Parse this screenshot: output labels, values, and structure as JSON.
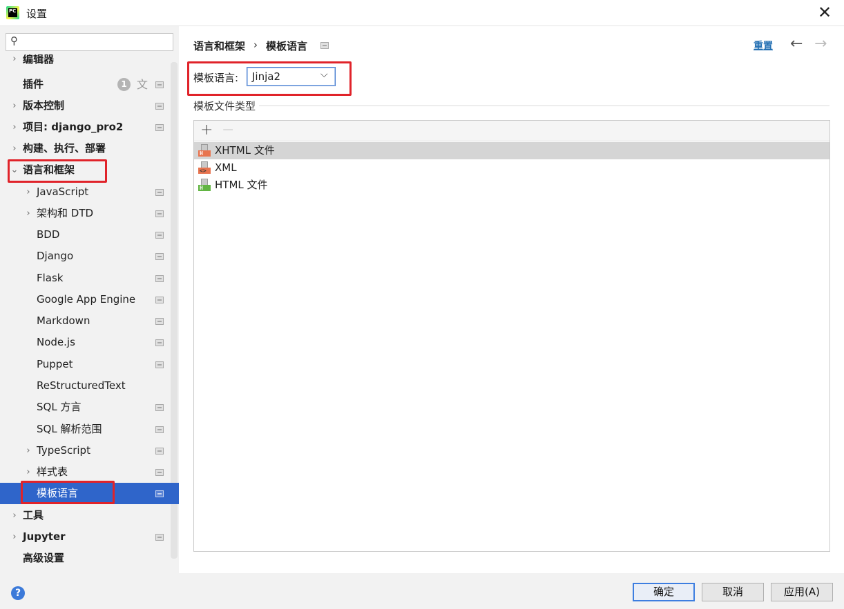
{
  "window": {
    "title": "设置",
    "app_icon_text": "PC"
  },
  "sidebar": {
    "search_placeholder": "",
    "items": [
      {
        "label": "编辑器"
      },
      {
        "label": "插件",
        "badge": "1"
      },
      {
        "label": "版本控制"
      },
      {
        "label": "项目: django_pro2"
      },
      {
        "label": "构建、执行、部署"
      },
      {
        "label": "语言和框架"
      },
      {
        "label": "JavaScript"
      },
      {
        "label": "架构和 DTD"
      },
      {
        "label": "BDD"
      },
      {
        "label": "Django"
      },
      {
        "label": "Flask"
      },
      {
        "label": "Google App Engine"
      },
      {
        "label": "Markdown"
      },
      {
        "label": "Node.js"
      },
      {
        "label": "Puppet"
      },
      {
        "label": "ReStructuredText"
      },
      {
        "label": "SQL 方言"
      },
      {
        "label": "SQL 解析范围"
      },
      {
        "label": "TypeScript"
      },
      {
        "label": "样式表"
      },
      {
        "label": "模板语言"
      },
      {
        "label": "工具"
      },
      {
        "label": "Jupyter"
      },
      {
        "label": "高级设置"
      }
    ]
  },
  "main": {
    "breadcrumb": {
      "parent": "语言和框架",
      "separator": "›",
      "current": "模板语言"
    },
    "reset_label": "重置",
    "template_language": {
      "label": "模板语言:",
      "value": "Jinja2"
    },
    "file_types": {
      "group_title": "模板文件类型",
      "add_label": "+",
      "remove_label": "−",
      "files": [
        {
          "name": "XHTML 文件",
          "icon_tag": "H",
          "icon_color": "#e8744f"
        },
        {
          "name": "XML",
          "icon_tag": "<>",
          "icon_color": "#e8744f"
        },
        {
          "name": "HTML 文件",
          "icon_tag": "H",
          "icon_color": "#62b543"
        }
      ]
    }
  },
  "footer": {
    "help": "?",
    "ok_label": "确定",
    "cancel_label": "取消",
    "apply_label": "应用(A)"
  },
  "colors": {
    "selection": "#2f65ca",
    "highlight_box": "#e0232a",
    "link": "#2470b3"
  }
}
